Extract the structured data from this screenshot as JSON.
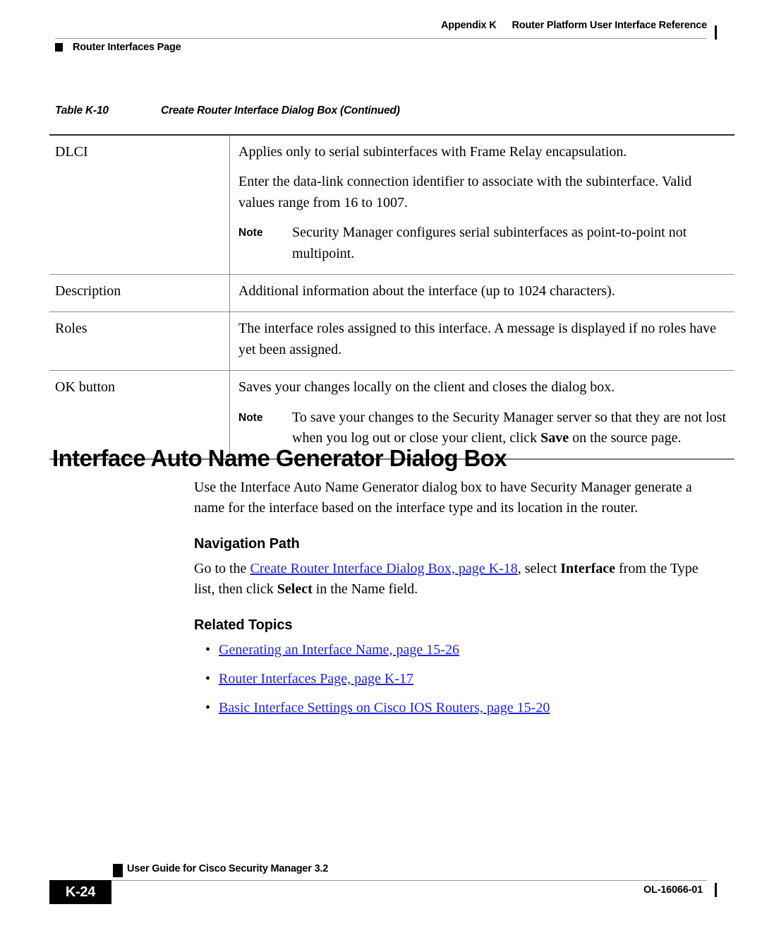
{
  "header": {
    "appendix": "Appendix K",
    "title": "Router Platform User Interface Reference",
    "section": "Router Interfaces Page"
  },
  "table": {
    "caption_number": "Table K-10",
    "caption_title": "Create Router Interface Dialog Box (Continued)",
    "note_label": "Note",
    "rows": [
      {
        "term": "DLCI",
        "paragraphs": [
          "Applies only to serial subinterfaces with Frame Relay encapsulation.",
          "Enter the data-link connection identifier to associate with the subinterface. Valid values range from 16 to 1007."
        ],
        "note": "Security Manager configures serial subinterfaces as point-to-point not multipoint."
      },
      {
        "term": "Description",
        "paragraphs": [
          "Additional information about the interface (up to 1024 characters)."
        ],
        "note": null
      },
      {
        "term": "Roles",
        "paragraphs": [
          "The interface roles assigned to this interface. A message is displayed if no roles have yet been assigned."
        ],
        "note": null
      },
      {
        "term": "OK button",
        "paragraphs": [
          "Saves your changes locally on the client and closes the dialog box."
        ],
        "note_parts": {
          "before": "To save your changes to the Security Manager server so that they are not lost when you log out or close your client, click ",
          "bold": "Save",
          "after": " on the source page."
        }
      }
    ]
  },
  "section": {
    "heading": "Interface Auto Name Generator Dialog Box",
    "intro": "Use the Interface Auto Name Generator dialog box to have Security Manager generate a name for the interface based on the interface type and its location in the router.",
    "navigation_heading": "Navigation Path",
    "navigation_path": {
      "before_link": "Go to the ",
      "link": "Create Router Interface Dialog Box, page K-18",
      "after_link": ", select ",
      "bold1": "Interface",
      "middle": " from the Type list, then click ",
      "bold2": "Select",
      "end": " in the Name field."
    },
    "related_heading": "Related Topics",
    "related_topics": [
      "Generating an Interface Name, page 15-26",
      "Router Interfaces Page, page K-17",
      "Basic Interface Settings on Cisco IOS Routers, page 15-20"
    ],
    "bullet_glyph": "•"
  },
  "footer": {
    "guide_title": "User Guide for Cisco Security Manager 3.2",
    "page_number": "K-24",
    "doc_id": "OL-16066-01"
  },
  "colors": {
    "link_blue": "#2222dd",
    "rule_gray": "#9a9a9a",
    "text_black": "#000000"
  }
}
